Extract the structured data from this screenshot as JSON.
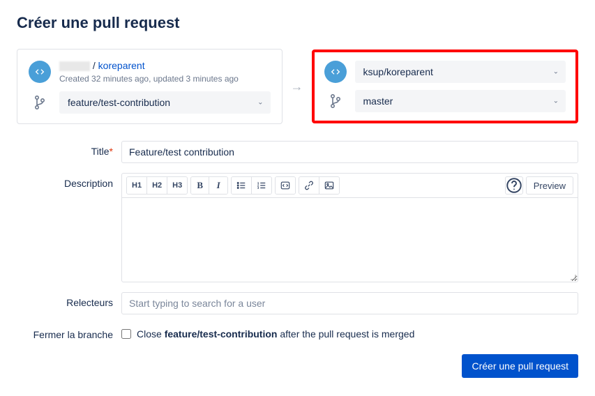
{
  "page_title": "Créer une pull request",
  "source": {
    "repo_separator": " / ",
    "repo_link": "koreparent",
    "meta": "Created 32 minutes ago, updated 3 minutes ago",
    "branch": "feature/test-contribution"
  },
  "target": {
    "repo": "ksup/koreparent",
    "branch": "master"
  },
  "form": {
    "title_label": "Title",
    "title_value": "Feature/test contribution",
    "description_label": "Description",
    "reviewers_label": "Relecteurs",
    "reviewers_placeholder": "Start typing to search for a user",
    "close_branch_label": "Fermer la branche",
    "close_text_prefix": "Close ",
    "close_text_branch": "feature/test-contribution",
    "close_text_suffix": " after the pull request is merged"
  },
  "toolbar": {
    "h1": "H1",
    "h2": "H2",
    "h3": "H3",
    "bold": "B",
    "italic": "I",
    "preview": "Preview",
    "help": "?"
  },
  "submit": "Créer une pull request"
}
